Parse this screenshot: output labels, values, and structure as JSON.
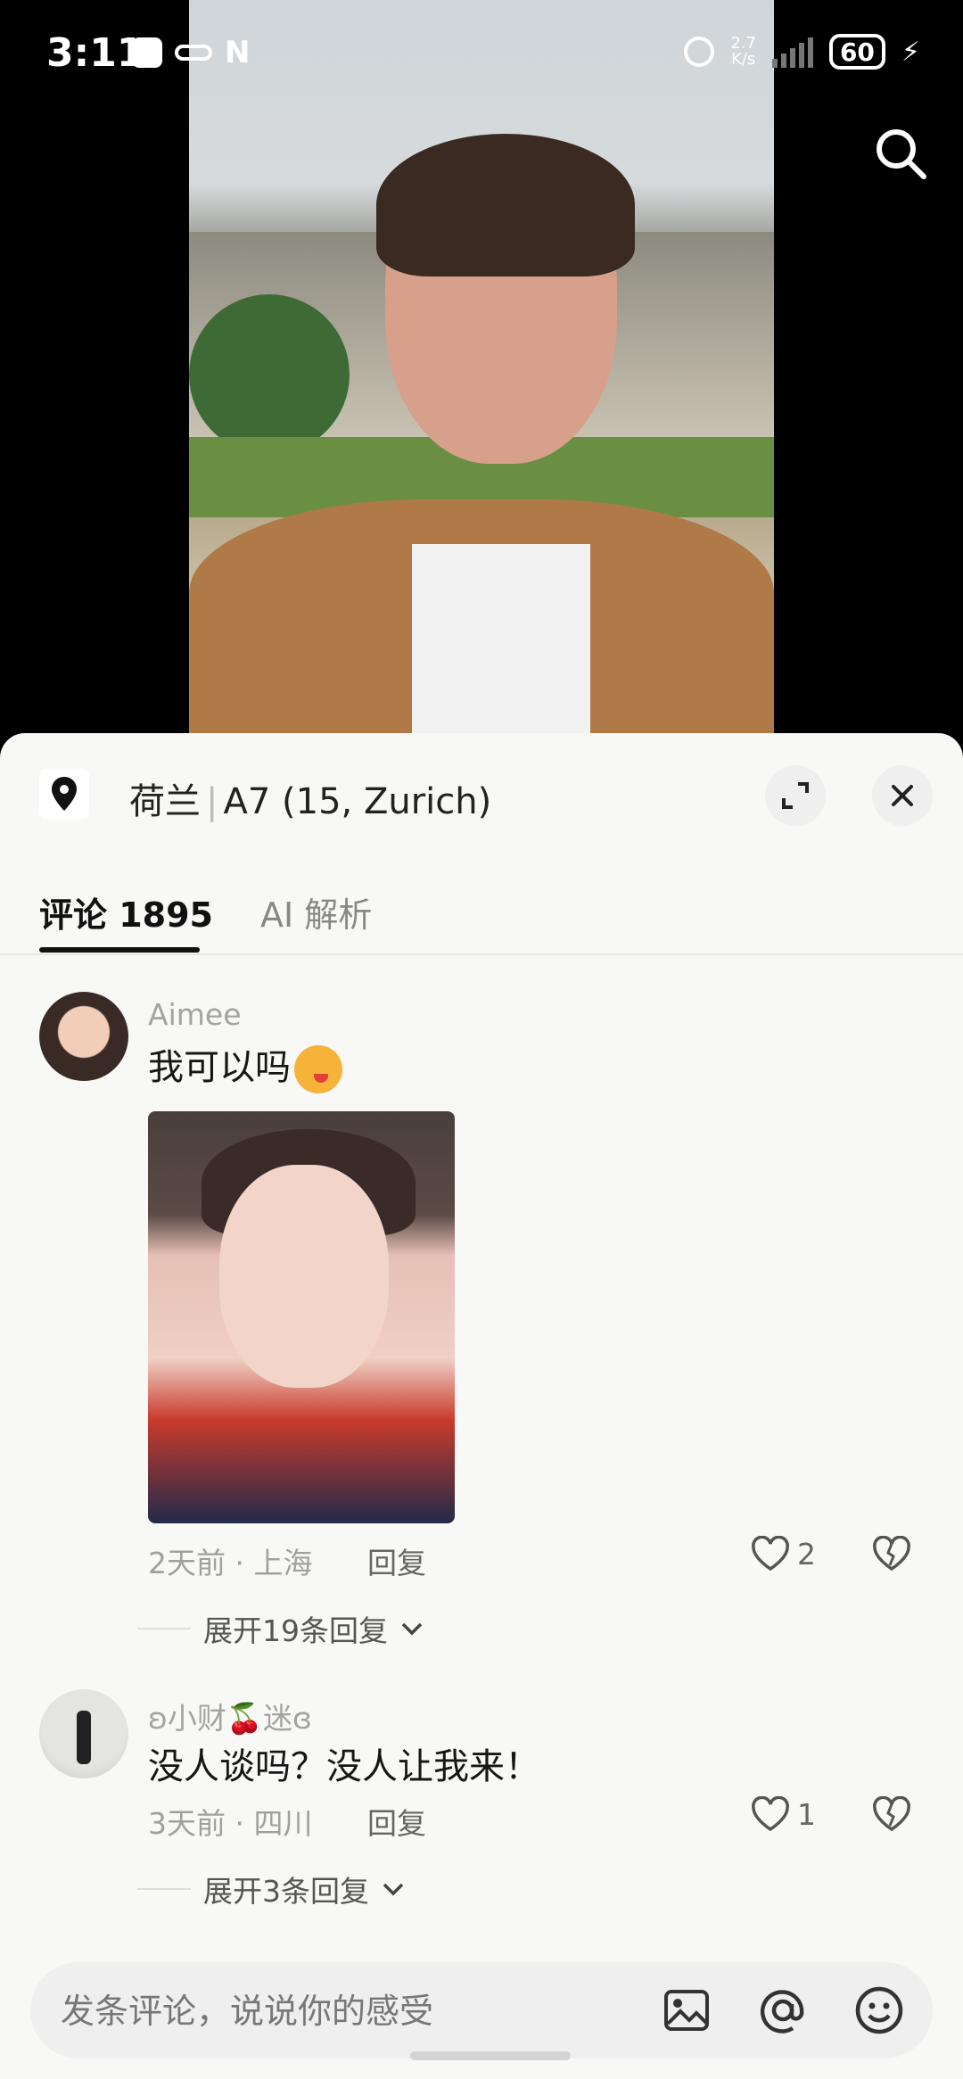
{
  "status_bar": {
    "time": "3:11",
    "net_speed_value": "2.7",
    "net_speed_unit": "K/s",
    "battery": "60",
    "nfc": "N"
  },
  "sheet": {
    "location_name": "荷兰",
    "location_detail": "A7 (15, Zurich)",
    "tabs": [
      {
        "label": "评论 1895"
      },
      {
        "label": "AI 解析"
      }
    ]
  },
  "comments": [
    {
      "user": "Aimee",
      "text": "我可以吗",
      "meta": "2天前 · 上海",
      "reply_label": "回复",
      "likes": "2",
      "expand_label": "展开19条回复"
    },
    {
      "user": "ʚ小财🍒迷ɞ",
      "text": "没人谈吗？没人让我来！",
      "meta": "3天前 · 四川",
      "reply_label": "回复",
      "likes": "1",
      "expand_label": "展开3条回复"
    }
  ],
  "input": {
    "placeholder": "发条评论，说说你的感受"
  },
  "icons": {
    "search": "search-icon",
    "location": "location-pin-icon",
    "expand": "expand-icon",
    "close": "close-icon",
    "like": "heart-icon",
    "dislike": "broken-heart-icon",
    "image": "image-icon",
    "mention": "at-icon",
    "emoji": "emoji-icon"
  }
}
